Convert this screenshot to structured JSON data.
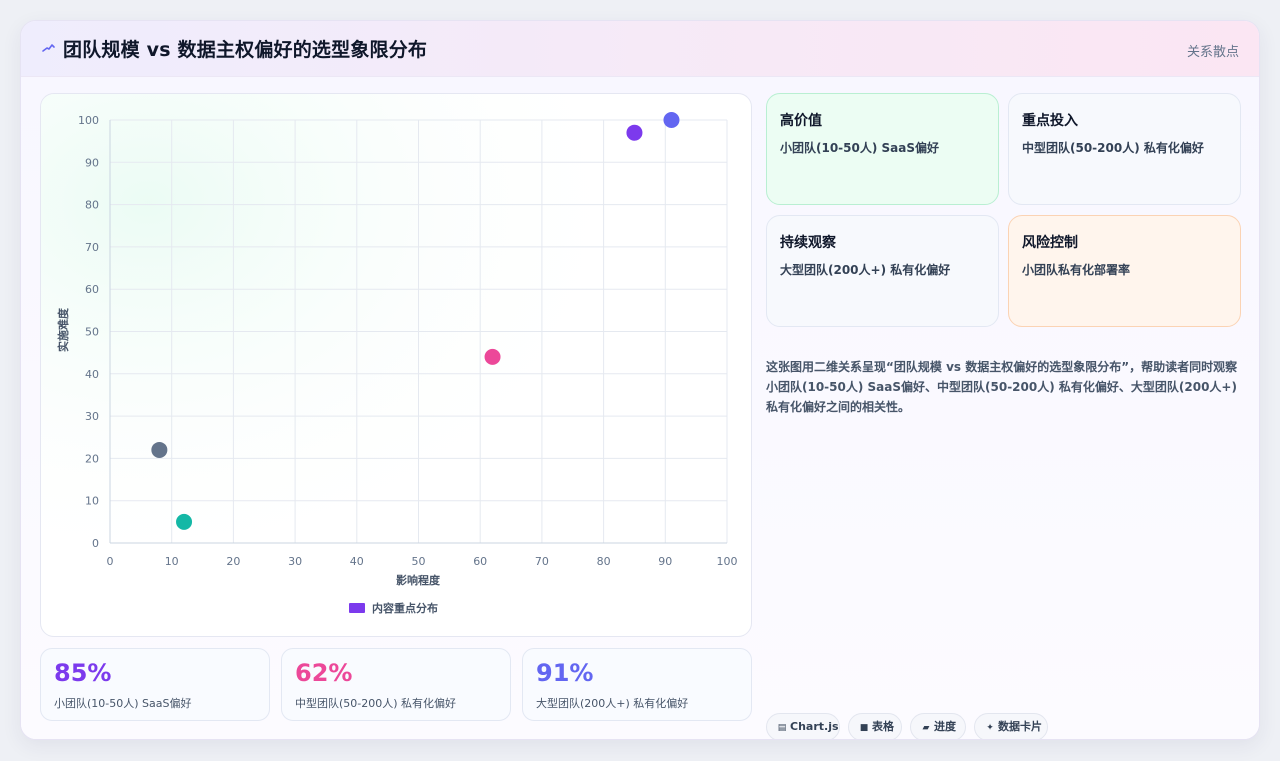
{
  "header": {
    "title": "团队规模 vs 数据主权偏好的选型象限分布",
    "badge": "关系散点"
  },
  "colors": {
    "purple": "#7c3aed",
    "indigo": "#6366f1",
    "pink": "#ec4899",
    "slate": "#64748b",
    "teal": "#14b8a6"
  },
  "chart_data": {
    "type": "scatter",
    "xlabel": "影响程度",
    "ylabel": "实施难度",
    "xlim": [
      0,
      100
    ],
    "ylim": [
      0,
      100
    ],
    "x_ticks": [
      "0",
      "10",
      "20",
      "30",
      "40",
      "50",
      "60",
      "70",
      "80",
      "90",
      "100"
    ],
    "y_ticks": [
      "0",
      "10",
      "20",
      "30",
      "40",
      "50",
      "60",
      "70",
      "80",
      "90",
      "100"
    ],
    "grid": true,
    "legend_position": "bottom",
    "series": [
      {
        "name": "内容重点分布",
        "color": "#7c3aed",
        "points": [
          {
            "x": 85,
            "y": 97,
            "color": "#7c3aed"
          },
          {
            "x": 91,
            "y": 100,
            "color": "#6366f1"
          },
          {
            "x": 62,
            "y": 44,
            "color": "#ec4899"
          },
          {
            "x": 8,
            "y": 22,
            "color": "#64748b"
          },
          {
            "x": 12,
            "y": 5,
            "color": "#14b8a6"
          }
        ]
      }
    ]
  },
  "stats": [
    {
      "value": "85%",
      "label": "小团队(10-50人) SaaS偏好",
      "color": "#7c3aed"
    },
    {
      "value": "62%",
      "label": "中型团队(50-200人) 私有化偏好",
      "color": "#ec4899"
    },
    {
      "value": "91%",
      "label": "大型团队(200人+) 私有化偏好",
      "color": "#6366f1"
    }
  ],
  "quadrants": [
    {
      "title": "高价值",
      "desc": "小团队(10-50人) SaaS偏好"
    },
    {
      "title": "重点投入",
      "desc": "中型团队(50-200人) 私有化偏好"
    },
    {
      "title": "持续观察",
      "desc": "大型团队(200人+) 私有化偏好"
    },
    {
      "title": "风险控制",
      "desc": "小团队私有化部署率"
    }
  ],
  "description": "这张图用二维关系呈现“团队规模 vs 数据主权偏好的选型象限分布”，帮助读者同时观察小团队(10-50人) SaaS偏好、中型团队(50-200人) 私有化偏好、大型团队(200人+) 私有化偏好之间的相关性。",
  "tags": [
    {
      "label": "Chart.js",
      "icon": "chart-icon"
    },
    {
      "label": "表格",
      "icon": "table-icon"
    },
    {
      "label": "进度",
      "icon": "progress-icon"
    },
    {
      "label": "数据卡片",
      "icon": "sparkle-icon"
    }
  ]
}
